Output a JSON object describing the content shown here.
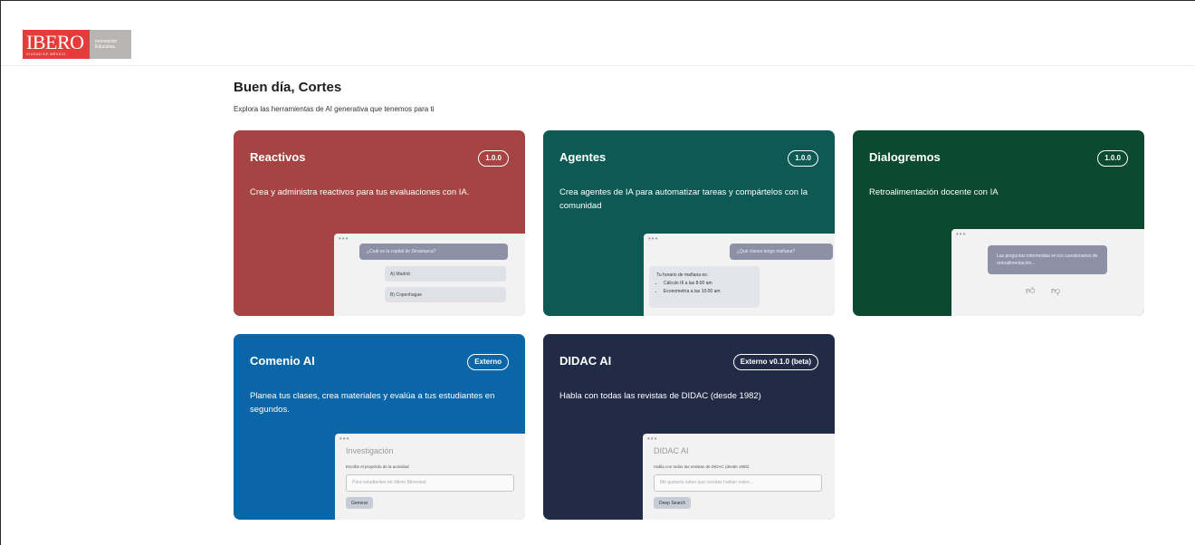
{
  "header": {
    "logo_text": "IBERO",
    "logo_subtext": "CIUDAD DE MÉXICO",
    "logo_tagline": "Innovación Educativa"
  },
  "greeting": "Buen día, Cortes",
  "subtitle": "Explora las herramientas de AI generativa que tenemos para ti",
  "cards": [
    {
      "title": "Reactivos",
      "badge": "1.0.0",
      "description": "Crea y administra reactivos para tus evaluaciones con IA.",
      "mock": {
        "question": "¿Cuál es la capital de Dinamarca?",
        "options": [
          "A) Madrid",
          "B) Copenhague"
        ]
      }
    },
    {
      "title": "Agentes",
      "badge": "1.0.0",
      "description": "Crea agentes de IA para automatizar tareas y compártelos con la comunidad",
      "mock": {
        "question": "¿Qué clases tengo mañana?",
        "answer_intro": "Tu horario de mañana es:",
        "answer_items": [
          "Cálculo III a las 8:00 am",
          "Econometría a las 10:00 am"
        ]
      }
    },
    {
      "title": "Dialogremos",
      "badge": "1.0.0",
      "description": "Retroalimentación docente con IA",
      "mock": {
        "message": "Las preguntas intermedias en los cuestionarios de retroalimentación..."
      }
    },
    {
      "title": "Comenio AI",
      "badge": "Externo",
      "description": "Planea tus clases, crea materiales y evalúa a tus estudiantes en segundos.",
      "mock": {
        "title": "Investigación",
        "label": "Escribe el propósito de la actividad",
        "placeholder": "Para estudiantes de último Bimestral",
        "button": "Generar"
      }
    },
    {
      "title": "DIDAC AI",
      "badge": "Externo v0.1.0 (beta)",
      "description": "Habla con todas las revistas de DIDAC (desde 1982)",
      "mock": {
        "title": "DIDAC AI",
        "label": "Habla con todas las revistas de DIDAC (desde 1982)",
        "placeholder": "Me gustaría saber que revistas hablan sobre...",
        "button": "Deep Search"
      }
    }
  ]
}
